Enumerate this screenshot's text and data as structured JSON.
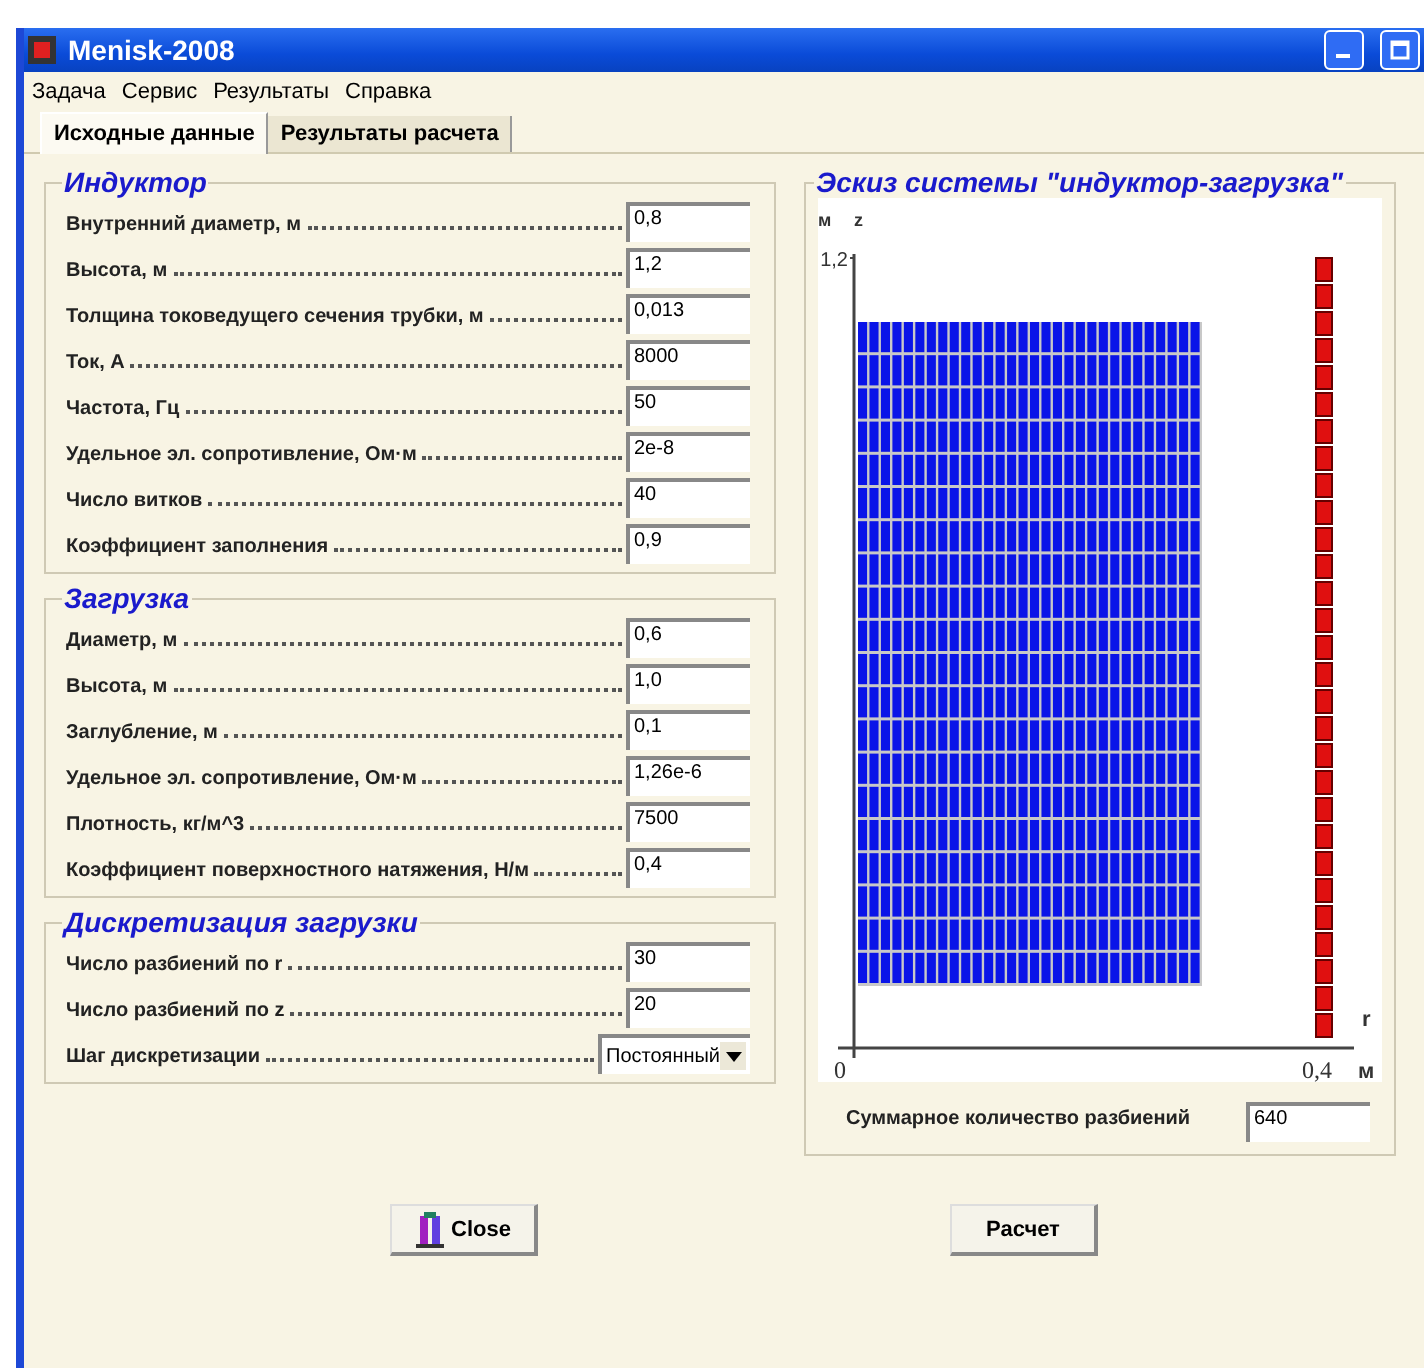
{
  "window": {
    "title": "Menisk-2008"
  },
  "menu": [
    "Задача",
    "Сервис",
    "Результаты",
    "Справка"
  ],
  "tabs": [
    {
      "label": "Исходные данные",
      "selected": true
    },
    {
      "label": "Результаты расчета",
      "selected": false
    }
  ],
  "groups": [
    {
      "title": "Индуктор",
      "fields": [
        {
          "kind": "input",
          "label": "Внутренний диаметр, м",
          "value": "0,8"
        },
        {
          "kind": "input",
          "label": "Высота, м",
          "value": "1,2"
        },
        {
          "kind": "input",
          "label": "Толщина токоведущего сечения трубки, м",
          "value": "0,013"
        },
        {
          "kind": "input",
          "label": "Ток, А",
          "value": "8000"
        },
        {
          "kind": "input",
          "label": "Частота, Гц",
          "value": "50"
        },
        {
          "kind": "input",
          "label": "Удельное эл. сопротивление, Ом·м",
          "value": "2e-8"
        },
        {
          "kind": "input",
          "label": "Число витков",
          "value": "40"
        },
        {
          "kind": "input",
          "label": "Коэффициент заполнения",
          "value": "0,9"
        }
      ]
    },
    {
      "title": "Загрузка",
      "fields": [
        {
          "kind": "input",
          "label": "Диаметр, м",
          "value": "0,6"
        },
        {
          "kind": "input",
          "label": "Высота, м",
          "value": "1,0"
        },
        {
          "kind": "input",
          "label": "Заглубление, м",
          "value": "0,1"
        },
        {
          "kind": "input",
          "label": "Удельное эл. сопротивление, Ом·м",
          "value": "1,26e-6"
        },
        {
          "kind": "input",
          "label": "Плотность, кг/м^3",
          "value": "7500"
        },
        {
          "kind": "input",
          "label": "Коэффициент поверхностного натяжения, Н/м",
          "value": "0,4"
        }
      ]
    },
    {
      "title": "Дискретизация загрузки",
      "fields": [
        {
          "kind": "input",
          "label": "Число разбиений по r",
          "value": "30"
        },
        {
          "kind": "input",
          "label": "Число разбиений по z",
          "value": "20"
        },
        {
          "kind": "select",
          "label": "Шаг дискретизации",
          "value": "Постоянный"
        }
      ]
    }
  ],
  "sketch": {
    "title": "Эскиз системы \"индуктор-загрузка\"",
    "unit_z": "м",
    "axis_z": "z",
    "z_max": "1,2",
    "origin": "0",
    "r_max": "0,4",
    "axis_r": "r",
    "unit_r": "м",
    "total_label": "Суммарное количество разбиений",
    "total_value": "640"
  },
  "buttons": [
    {
      "kind": "close",
      "label": "Close"
    },
    {
      "kind": "plain",
      "label": "Расчет"
    }
  ]
}
